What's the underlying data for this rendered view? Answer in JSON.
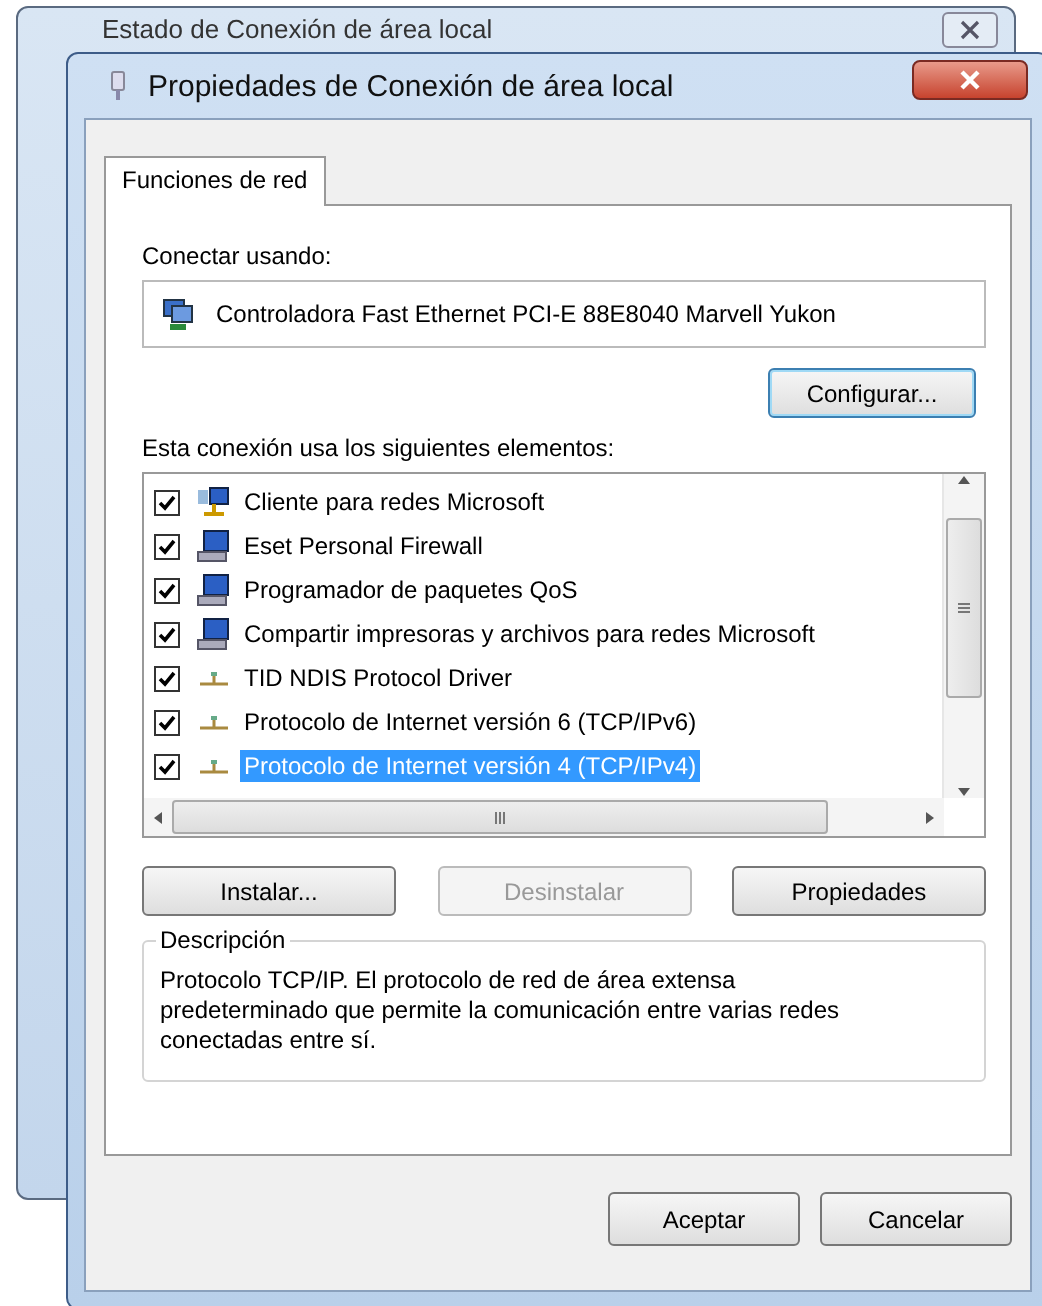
{
  "background_window": {
    "title": "Estado de Conexión de área local"
  },
  "window": {
    "title": "Propiedades de Conexión de área local"
  },
  "tabs": [
    {
      "label": "Funciones de red",
      "selected": true
    }
  ],
  "connect_using": {
    "label": "Conectar usando:",
    "adapter": "Controladora Fast Ethernet PCI-E 88E8040 Marvell Yukon",
    "button": "Configurar..."
  },
  "components": {
    "label": "Esta conexión usa los siguientes elementos:",
    "items": [
      {
        "kind": "client",
        "name": "Cliente para redes Microsoft",
        "checked": true,
        "selected": false
      },
      {
        "kind": "service",
        "name": "Eset Personal Firewall",
        "checked": true,
        "selected": false
      },
      {
        "kind": "service",
        "name": "Programador de paquetes QoS",
        "checked": true,
        "selected": false
      },
      {
        "kind": "service",
        "name": "Compartir impresoras y archivos para redes Microsoft",
        "checked": true,
        "selected": false
      },
      {
        "kind": "protocol",
        "name": "TID NDIS Protocol Driver",
        "checked": true,
        "selected": false
      },
      {
        "kind": "protocol",
        "name": "Protocolo de Internet versión 6 (TCP/IPv6)",
        "checked": true,
        "selected": false
      },
      {
        "kind": "protocol",
        "name": "Protocolo de Internet versión 4 (TCP/IPv4)",
        "checked": true,
        "selected": true
      }
    ]
  },
  "actions": [
    {
      "label": "Instalar...",
      "disabled": false
    },
    {
      "label": "Desinstalar",
      "disabled": true
    },
    {
      "label": "Propiedades",
      "disabled": false
    }
  ],
  "description": {
    "title": "Descripción",
    "text": "Protocolo TCP/IP. El protocolo de red de área extensa predeterminado que permite la comunicación entre varias redes conectadas entre sí."
  },
  "buttons": [
    "Aceptar",
    "Cancelar"
  ]
}
